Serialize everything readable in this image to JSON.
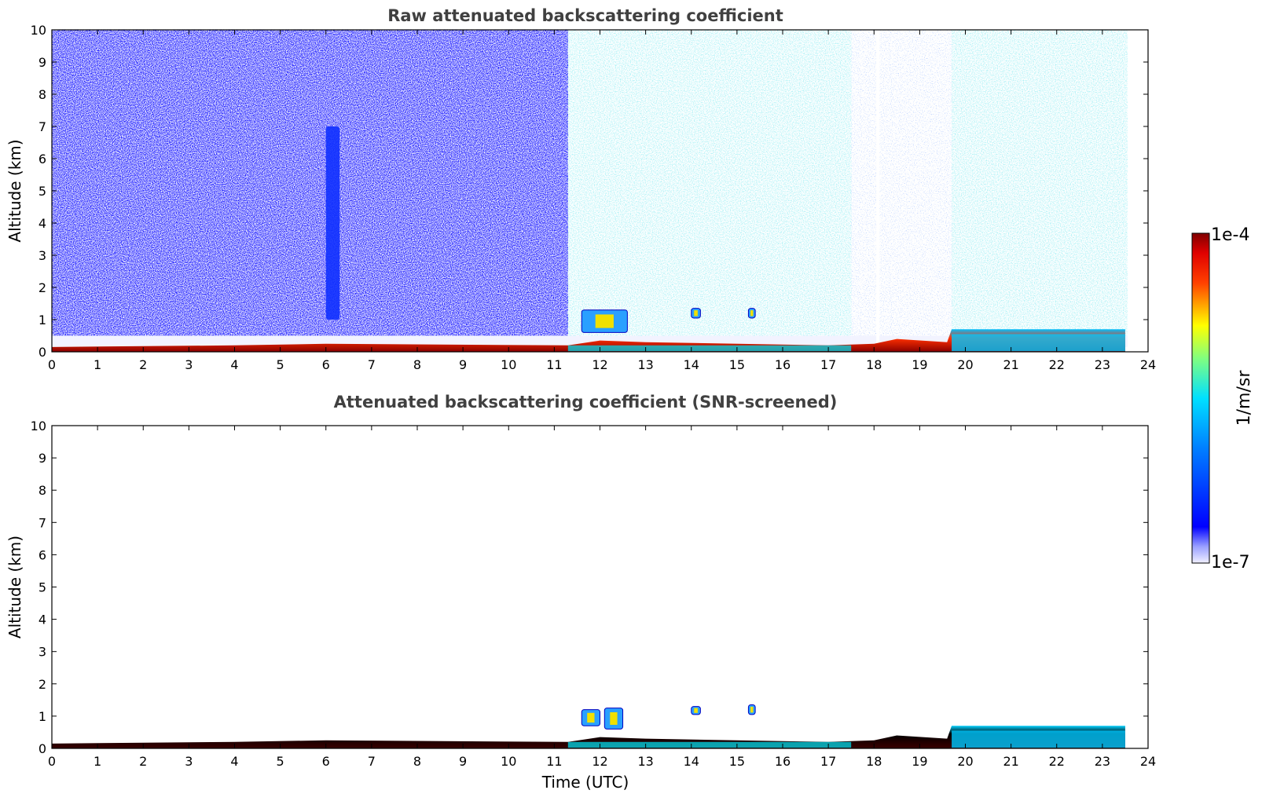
{
  "chart_data": [
    {
      "type": "heatmap",
      "title": "Raw attenuated backscattering coefficient",
      "xlabel": "",
      "ylabel": "Altitude (km)",
      "xlim": [
        0,
        24
      ],
      "ylim": [
        0,
        10
      ],
      "xticks": [
        "0",
        "1",
        "2",
        "3",
        "4",
        "5",
        "6",
        "7",
        "8",
        "9",
        "10",
        "11",
        "12",
        "13",
        "14",
        "15",
        "16",
        "17",
        "18",
        "19",
        "20",
        "21",
        "22",
        "23",
        "24"
      ],
      "yticks": [
        "0",
        "1",
        "2",
        "3",
        "4",
        "5",
        "6",
        "7",
        "8",
        "9",
        "10"
      ],
      "data_end_hour": 23.55,
      "boundary_layer_top_km": [
        {
          "t": 0,
          "z": 0.15
        },
        {
          "t": 4,
          "z": 0.2
        },
        {
          "t": 6,
          "z": 0.25
        },
        {
          "t": 11.3,
          "z": 0.2
        },
        {
          "t": 12,
          "z": 0.35
        },
        {
          "t": 13,
          "z": 0.3
        },
        {
          "t": 17,
          "z": 0.2
        },
        {
          "t": 18,
          "z": 0.25
        },
        {
          "t": 18.5,
          "z": 0.4
        },
        {
          "t": 19.6,
          "z": 0.3
        },
        {
          "t": 19.7,
          "z": 0.7
        },
        {
          "t": 23.5,
          "z": 0.7
        }
      ],
      "background_regions": [
        {
          "t0": 0,
          "t1": 11.3,
          "level": "high-blue"
        },
        {
          "t0": 11.3,
          "t1": 17.5,
          "level": "mixed-cyan"
        },
        {
          "t0": 17.5,
          "t1": 18.4,
          "level": "sparse"
        },
        {
          "t0": 18.4,
          "t1": 19.7,
          "level": "sparse"
        },
        {
          "t0": 19.7,
          "t1": 23.55,
          "level": "mixed-cyan"
        }
      ],
      "features": [
        {
          "kind": "aerosol plume",
          "t0": 6.0,
          "t1": 6.3,
          "z0": 1.0,
          "z1": 7.0
        },
        {
          "kind": "low cloud",
          "t0": 11.6,
          "t1": 12.6,
          "z0": 0.6,
          "z1": 1.3
        },
        {
          "kind": "low cloud",
          "t0": 14.0,
          "t1": 14.2,
          "z0": 1.05,
          "z1": 1.35
        },
        {
          "kind": "low cloud",
          "t0": 15.25,
          "t1": 15.4,
          "z0": 1.05,
          "z1": 1.35
        }
      ]
    },
    {
      "type": "heatmap",
      "title": "Attenuated backscattering coefficient (SNR-screened)",
      "xlabel": "Time (UTC)",
      "ylabel": "Altitude (km)",
      "xlim": [
        0,
        24
      ],
      "ylim": [
        0,
        10
      ],
      "xticks": [
        "0",
        "1",
        "2",
        "3",
        "4",
        "5",
        "6",
        "7",
        "8",
        "9",
        "10",
        "11",
        "12",
        "13",
        "14",
        "15",
        "16",
        "17",
        "18",
        "19",
        "20",
        "21",
        "22",
        "23",
        "24"
      ],
      "yticks": [
        "0",
        "1",
        "2",
        "3",
        "4",
        "5",
        "6",
        "7",
        "8",
        "9",
        "10"
      ],
      "data_end_hour": 23.55,
      "features": [
        {
          "kind": "low cloud",
          "t0": 11.6,
          "t1": 12.0,
          "z0": 0.7,
          "z1": 1.2
        },
        {
          "kind": "low cloud",
          "t0": 12.1,
          "t1": 12.5,
          "z0": 0.6,
          "z1": 1.25
        },
        {
          "kind": "low cloud",
          "t0": 14.0,
          "t1": 14.2,
          "z0": 1.05,
          "z1": 1.3
        },
        {
          "kind": "low cloud",
          "t0": 15.25,
          "t1": 15.4,
          "z0": 1.05,
          "z1": 1.35
        }
      ]
    }
  ],
  "colorbar": {
    "label": "1/m/sr",
    "max_label": "1e-4",
    "min_label": "1e-7",
    "colormap": "jet",
    "colors": [
      "#e8e8ff",
      "#0000ff",
      "#00ffff",
      "#ffff00",
      "#ff0000",
      "#7f0000"
    ]
  }
}
